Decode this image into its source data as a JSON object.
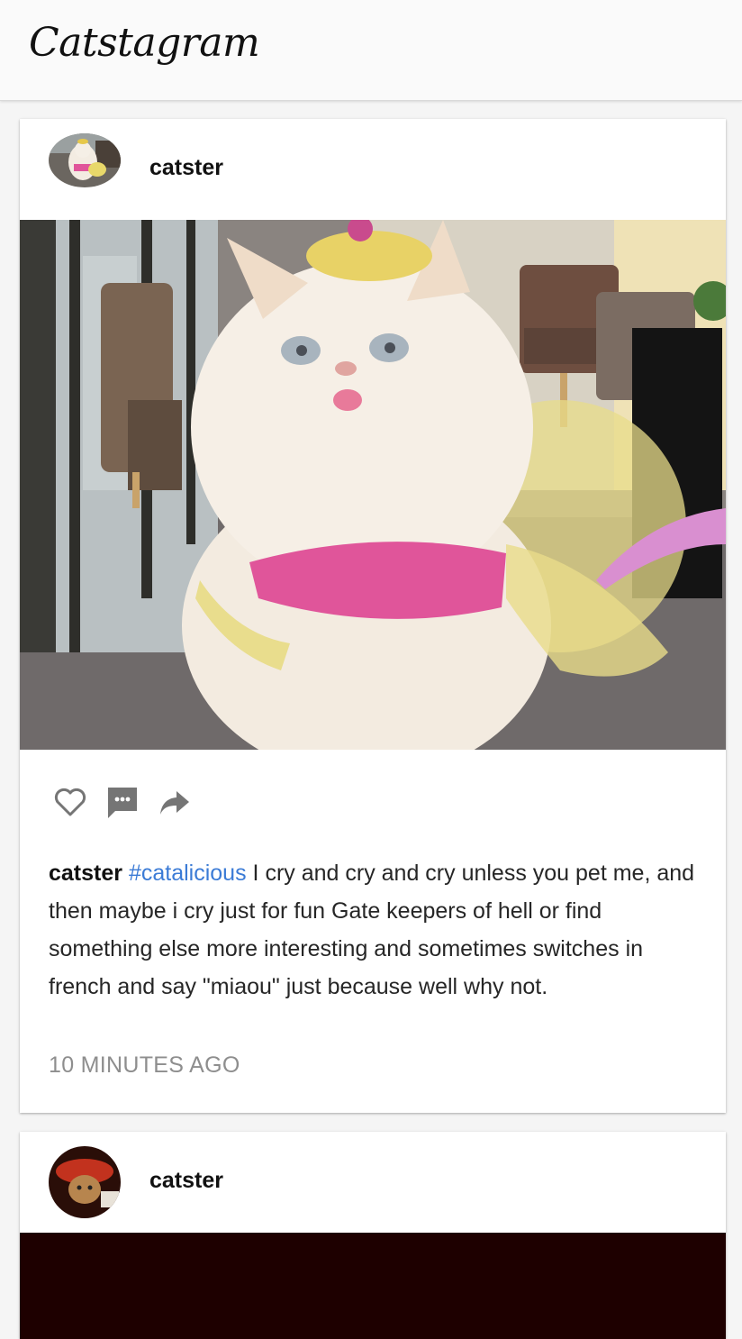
{
  "app": {
    "title": "Catstagram"
  },
  "posts": [
    {
      "username": "catster",
      "hashtag": "#catalicious",
      "caption": "I cry and cry and cry unless you pet me, and then maybe i cry just for fun Gate keepers of hell or find something else more interesting and sometimes switches in french and say \"miaou\" just because well why not.",
      "timestamp": "10 MINUTES AGO",
      "actions": [
        "heart-icon",
        "comment-icon",
        "share-icon"
      ]
    },
    {
      "username": "catster"
    }
  ],
  "colors": {
    "hashtag": "#3b7bd6",
    "timestamp": "#8e8e8e",
    "icon": "#757575"
  }
}
